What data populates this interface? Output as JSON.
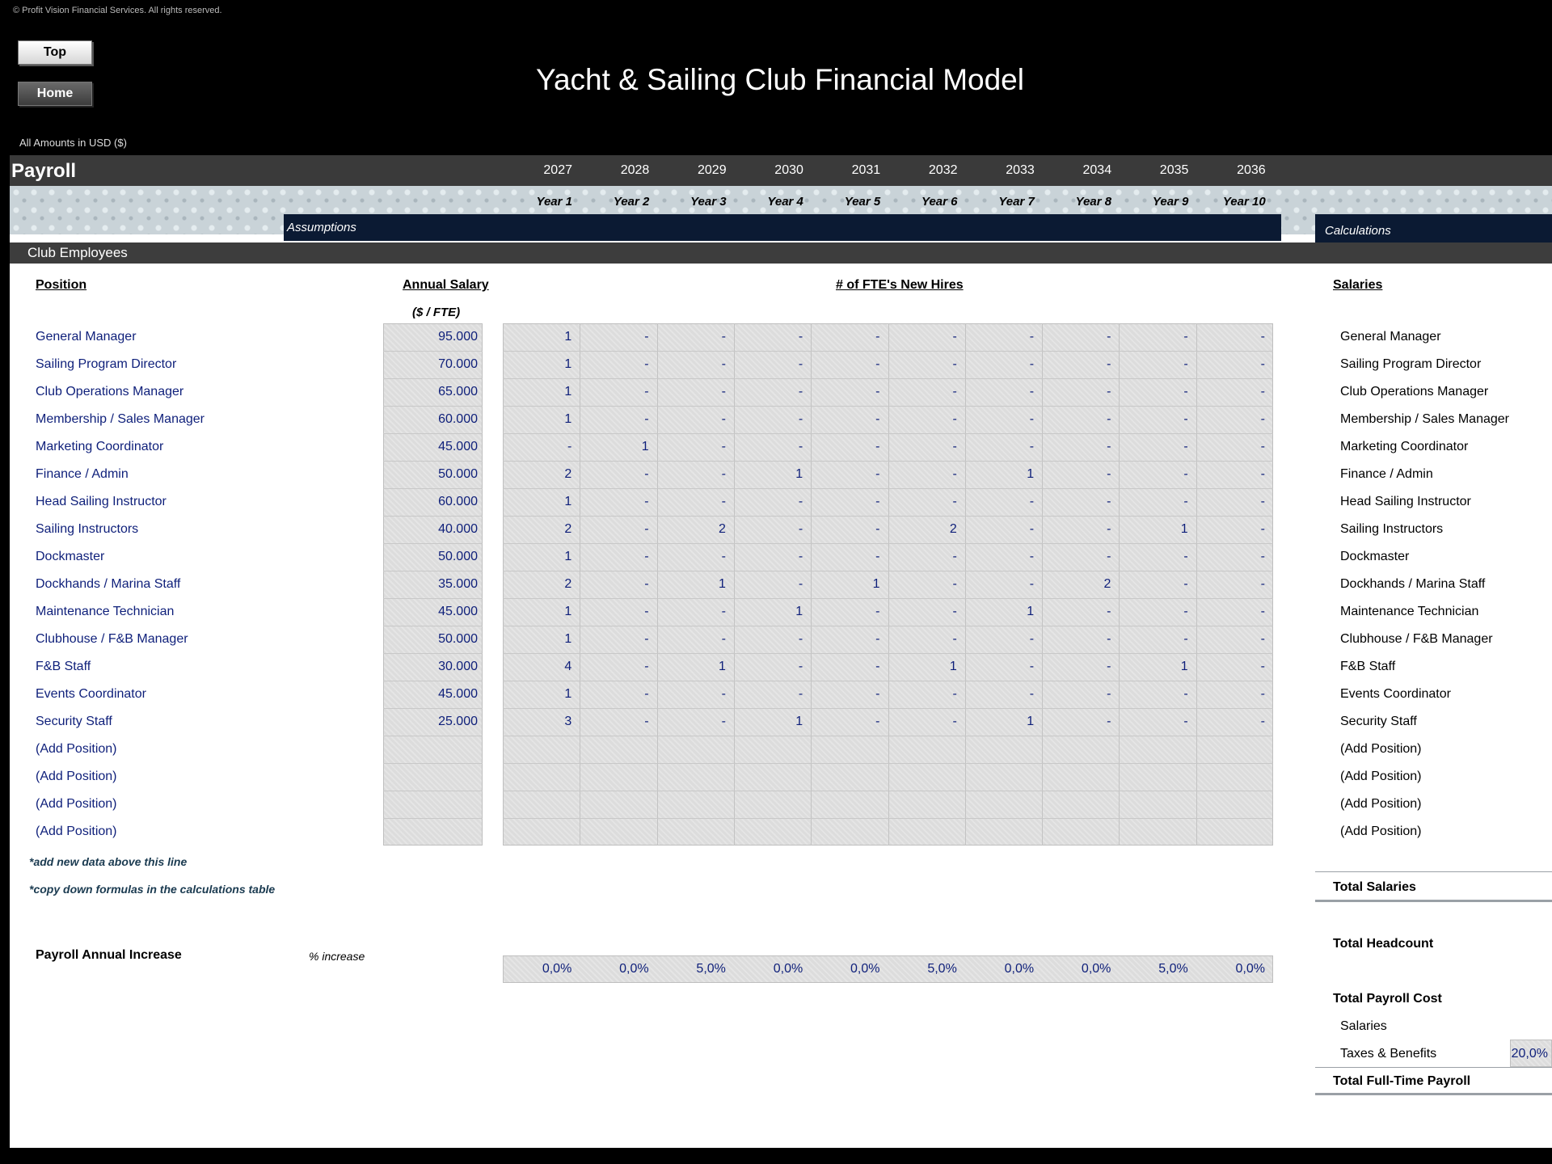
{
  "copyright": "© Profit Vision Financial Services. All rights reserved.",
  "buttons": {
    "top": "Top",
    "home": "Home"
  },
  "title": "Yacht & Sailing Club Financial Model",
  "amounts_note": "All Amounts in  USD ($)",
  "section": "Payroll",
  "years": [
    "2027",
    "2028",
    "2029",
    "2030",
    "2031",
    "2032",
    "2033",
    "2034",
    "2035",
    "2036"
  ],
  "year_labels": [
    "Year 1",
    "Year 2",
    "Year 3",
    "Year 4",
    "Year 5",
    "Year 6",
    "Year 7",
    "Year 8",
    "Year 9",
    "Year 10"
  ],
  "assumptions_label": "Assumptions",
  "calculations_label": "Calculations",
  "subsection": "Club Employees",
  "headers": {
    "position": "Position",
    "annual_salary": "Annual Salary",
    "salary_unit": "($ / FTE)",
    "fte": "# of FTE's New Hires",
    "salaries": "Salaries"
  },
  "positions": [
    {
      "name": "General Manager",
      "salary": "95.000",
      "hires": [
        "1",
        "-",
        "-",
        "-",
        "-",
        "-",
        "-",
        "-",
        "-",
        "-"
      ]
    },
    {
      "name": "Sailing Program Director",
      "salary": "70.000",
      "hires": [
        "1",
        "-",
        "-",
        "-",
        "-",
        "-",
        "-",
        "-",
        "-",
        "-"
      ]
    },
    {
      "name": "Club Operations Manager",
      "salary": "65.000",
      "hires": [
        "1",
        "-",
        "-",
        "-",
        "-",
        "-",
        "-",
        "-",
        "-",
        "-"
      ]
    },
    {
      "name": "Membership / Sales Manager",
      "salary": "60.000",
      "hires": [
        "1",
        "-",
        "-",
        "-",
        "-",
        "-",
        "-",
        "-",
        "-",
        "-"
      ]
    },
    {
      "name": "Marketing Coordinator",
      "salary": "45.000",
      "hires": [
        "-",
        "1",
        "-",
        "-",
        "-",
        "-",
        "-",
        "-",
        "-",
        "-"
      ]
    },
    {
      "name": "Finance / Admin",
      "salary": "50.000",
      "hires": [
        "2",
        "-",
        "-",
        "1",
        "-",
        "-",
        "1",
        "-",
        "-",
        "-"
      ]
    },
    {
      "name": "Head Sailing Instructor",
      "salary": "60.000",
      "hires": [
        "1",
        "-",
        "-",
        "-",
        "-",
        "-",
        "-",
        "-",
        "-",
        "-"
      ]
    },
    {
      "name": "Sailing Instructors",
      "salary": "40.000",
      "hires": [
        "2",
        "-",
        "2",
        "-",
        "-",
        "2",
        "-",
        "-",
        "1",
        "-"
      ]
    },
    {
      "name": "Dockmaster",
      "salary": "50.000",
      "hires": [
        "1",
        "-",
        "-",
        "-",
        "-",
        "-",
        "-",
        "-",
        "-",
        "-"
      ]
    },
    {
      "name": "Dockhands / Marina Staff",
      "salary": "35.000",
      "hires": [
        "2",
        "-",
        "1",
        "-",
        "1",
        "-",
        "-",
        "2",
        "-",
        "-"
      ]
    },
    {
      "name": "Maintenance Technician",
      "salary": "45.000",
      "hires": [
        "1",
        "-",
        "-",
        "1",
        "-",
        "-",
        "1",
        "-",
        "-",
        "-"
      ]
    },
    {
      "name": "Clubhouse / F&B Manager",
      "salary": "50.000",
      "hires": [
        "1",
        "-",
        "-",
        "-",
        "-",
        "-",
        "-",
        "-",
        "-",
        "-"
      ]
    },
    {
      "name": "F&B Staff",
      "salary": "30.000",
      "hires": [
        "4",
        "-",
        "1",
        "-",
        "-",
        "1",
        "-",
        "-",
        "1",
        "-"
      ]
    },
    {
      "name": "Events Coordinator",
      "salary": "45.000",
      "hires": [
        "1",
        "-",
        "-",
        "-",
        "-",
        "-",
        "-",
        "-",
        "-",
        "-"
      ]
    },
    {
      "name": "Security Staff",
      "salary": "25.000",
      "hires": [
        "3",
        "-",
        "-",
        "1",
        "-",
        "-",
        "1",
        "-",
        "-",
        "-"
      ]
    },
    {
      "name": "(Add Position)",
      "salary": "",
      "hires": [
        "",
        "",
        "",
        "",
        "",
        "",
        "",
        "",
        "",
        ""
      ]
    },
    {
      "name": "(Add Position)",
      "salary": "",
      "hires": [
        "",
        "",
        "",
        "",
        "",
        "",
        "",
        "",
        "",
        ""
      ]
    },
    {
      "name": "(Add Position)",
      "salary": "",
      "hires": [
        "",
        "",
        "",
        "",
        "",
        "",
        "",
        "",
        "",
        ""
      ]
    },
    {
      "name": "(Add Position)",
      "salary": "",
      "hires": [
        "",
        "",
        "",
        "",
        "",
        "",
        "",
        "",
        "",
        ""
      ]
    }
  ],
  "notes": {
    "add_data": "*add new data above this line",
    "copy_formulas": "*copy down formulas in the calculations table"
  },
  "payroll_increase": {
    "label": "Payroll Annual Increase",
    "unit": "% increase",
    "values": [
      "0,0%",
      "0,0%",
      "5,0%",
      "0,0%",
      "0,0%",
      "5,0%",
      "0,0%",
      "0,0%",
      "5,0%",
      "0,0%"
    ]
  },
  "calc": {
    "total_salaries": "Total Salaries",
    "total_headcount": "Total Headcount",
    "total_payroll_cost": "Total Payroll Cost",
    "salaries": "Salaries",
    "taxes_benefits": "Taxes & Benefits",
    "taxes_rate": "20,0%",
    "total_fulltime_payroll": "Total Full-Time Payroll"
  }
}
